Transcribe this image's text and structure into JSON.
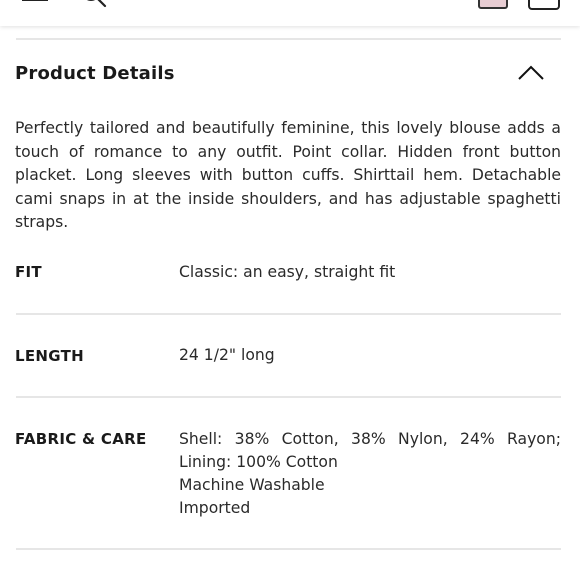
{
  "header": {
    "menu_icon": "hamburger-menu-icon",
    "search_icon": "search-icon",
    "bag_icon": "shopping-bag-icon",
    "cart_icon": "cart-icon"
  },
  "product_details": {
    "title": "Product Details",
    "toggle_icon": "chevron-up-icon",
    "description": "Perfectly tailored and beautifully feminine, this lovely blouse adds a touch of romance to any outfit. Point collar. Hidden front button placket. Long sleeves with button cuffs. Shirttail hem. Detachable cami snaps in at the inside shoulders, and has adjustable spaghetti straps."
  },
  "specs": [
    {
      "label": "FIT",
      "lines": [
        "Classic: an easy, straight fit"
      ]
    },
    {
      "label": "LENGTH",
      "lines": [
        "24 1/2\" long"
      ]
    },
    {
      "label": "FABRIC & CARE",
      "lines": [
        "Shell: 38% Cotton, 38% Nylon, 24% Rayon;",
        "Lining: 100% Cotton",
        "Machine Washable",
        "Imported"
      ]
    }
  ]
}
